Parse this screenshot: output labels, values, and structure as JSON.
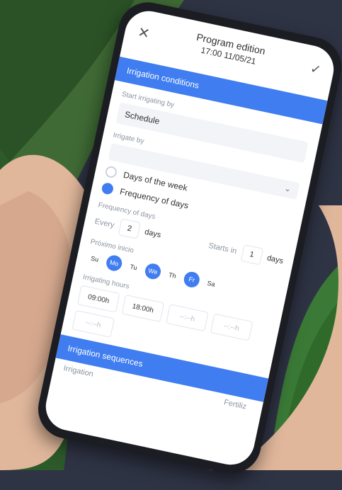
{
  "top": {
    "title": "Program edition",
    "subtitle": "17:00 11/05/21",
    "close_icon": "close-icon",
    "save_icon": "check-icon"
  },
  "section_conditions": {
    "label": "Irrigation conditions"
  },
  "start_by": {
    "label": "Start irrigating by",
    "value": "Schedule"
  },
  "irrigate_by": {
    "label": "Irrigate by",
    "options": [
      {
        "label": "Days of the week",
        "selected": false
      },
      {
        "label": "Frequency of days",
        "selected": true
      }
    ]
  },
  "frequency": {
    "label": "Frequency of days",
    "every_label": "Every",
    "every_value": "2",
    "days_label": "days",
    "starts_label": "Starts in",
    "starts_value": "1",
    "starts_days_label": "days"
  },
  "proximo": {
    "label": "Próximo inicio",
    "days": [
      {
        "label": "Su",
        "active": false
      },
      {
        "label": "Mo",
        "active": true
      },
      {
        "label": "Tu",
        "active": false
      },
      {
        "label": "We",
        "active": true
      },
      {
        "label": "Th",
        "active": false
      },
      {
        "label": "Fr",
        "active": true
      },
      {
        "label": "Sa",
        "active": false
      }
    ]
  },
  "hours": {
    "label": "Irrigating hours",
    "values": [
      "09:00h",
      "18:00h",
      "--:--h",
      "--:--h",
      "--:--h"
    ]
  },
  "section_sequences": {
    "label": "Irrigation sequences"
  },
  "bottom_peek": {
    "left": "Irrigation",
    "right": "Fertiliz"
  },
  "colors": {
    "accent": "#3f7df0",
    "background": "#2f3445"
  }
}
